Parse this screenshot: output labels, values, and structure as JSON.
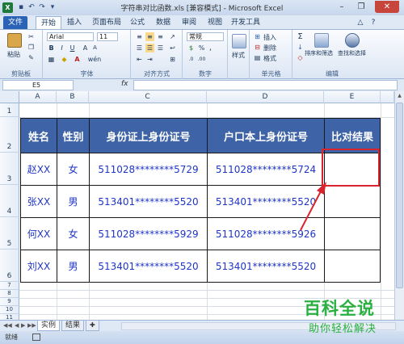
{
  "window": {
    "title": "字符串对比函数.xls [兼容模式] - Microsoft Excel",
    "app_letter": "X",
    "minimize": "–",
    "maximize": "❐",
    "close": "✕"
  },
  "ribbon_tabs": [
    "文件",
    "开始",
    "插入",
    "页面布局",
    "公式",
    "数据",
    "审阅",
    "视图",
    "开发工具"
  ],
  "ribbon": {
    "clipboard": {
      "paste": "粘贴",
      "label": "剪贴板"
    },
    "font": {
      "name": "Arial",
      "size": "11",
      "bold": "B",
      "italic": "I",
      "underline": "U",
      "grow": "A",
      "shrink": "A",
      "wen": "wén",
      "label": "字体"
    },
    "alignment": {
      "label": "对齐方式"
    },
    "number": {
      "format": "常规",
      "percent": "%",
      "comma": "，",
      "label": "数字"
    },
    "styles": {
      "styles": "样式"
    },
    "cells": {
      "insert": "插入",
      "delete": "删除",
      "format": "格式",
      "label": "单元格"
    },
    "editing": {
      "sum": "Σ",
      "sort": "排序和筛选",
      "find": "查找和选择",
      "label": "编辑"
    }
  },
  "formula_bar": {
    "name_box": "E5",
    "fx": "fx",
    "value": ""
  },
  "grid": {
    "columns": [
      "A",
      "B",
      "C",
      "D",
      "E"
    ],
    "rows": [
      "1",
      "2",
      "3",
      "4",
      "5",
      "6",
      "7",
      "8",
      "9",
      "10",
      "11"
    ],
    "headers": [
      "姓名",
      "性别",
      "身份证上身份证号",
      "户口本上身份证号",
      "比对结果"
    ],
    "data": [
      [
        "赵XX",
        "女",
        "511028********5729",
        "511028********5724",
        ""
      ],
      [
        "张XX",
        "男",
        "513401********5520",
        "513401********5520",
        ""
      ],
      [
        "何XX",
        "女",
        "511028********5929",
        "511028********5926",
        ""
      ],
      [
        "刘XX",
        "男",
        "513401********5520",
        "513401********5520",
        ""
      ]
    ]
  },
  "sheet_tabs": [
    "实例",
    "结果"
  ],
  "status": {
    "text": "就绪"
  },
  "watermark": {
    "main": "百科全说",
    "sub": "助你轻松解决"
  },
  "colors": {
    "header_fill": "#3e63a6",
    "data_text": "#1f35c8",
    "highlight": "#d9232d",
    "watermark": "#2ab040"
  }
}
